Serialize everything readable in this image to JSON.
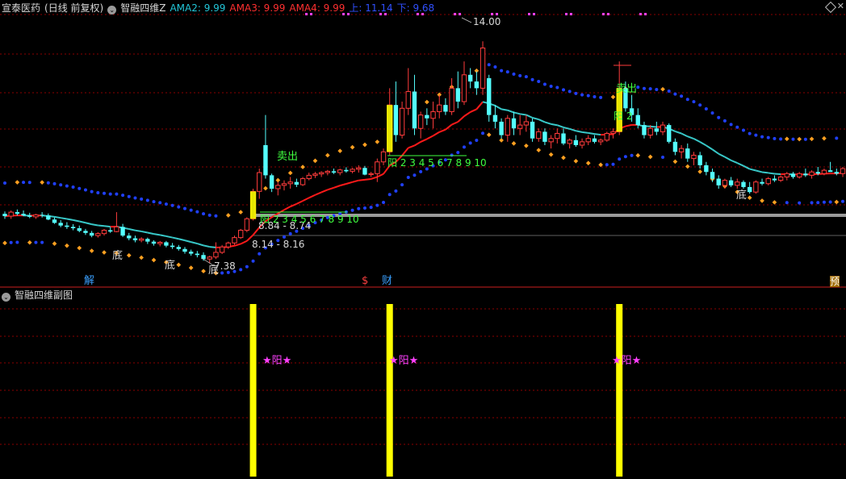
{
  "header": {
    "stock_name": "宣泰医药",
    "period": "(日线 前复权)",
    "indicator_name": "智融四维Z",
    "ama2_label": "AMA2: 9.99",
    "ama3_label": "AMA3: 9.99",
    "ama4_label": "AMA4: 9.99",
    "up_label": "上: 11.14",
    "down_label": "下: 9.68"
  },
  "sub_header": {
    "indicator_name": "智融四维副图"
  },
  "controls": {
    "close_glyph": "✕"
  },
  "annotations": {
    "peak_price": "14.00",
    "low_price": "7.38",
    "range_1": "8.14 - 8.16",
    "range_2": "8.84 - 8.74",
    "bottom_1": "底",
    "bottom_2": "底",
    "bottom_3": "底",
    "bottom_4": "底",
    "sell_1": "卖出",
    "sell_2": "卖出",
    "yang_count_1": "阳 2 3 4 5 6 7 8 9 10",
    "yang_count_2": "阳 2 3 4 5 6 7 8 9 10",
    "yang_count_3": "阳 2",
    "bottom_tag_jie": "解",
    "bottom_tag_dollar": "$",
    "bottom_tag_cai": "财",
    "bottom_tag_yu": "预",
    "sub_star_1": "★阳★",
    "sub_star_2": "★阳★",
    "sub_star_3": "★阳★"
  },
  "colors": {
    "background": "#000000",
    "candle_up": "#ff3c3c",
    "candle_down": "#54ffff",
    "ma_red": "#ff1a1a",
    "ma_cyan": "#38c8c8",
    "dots_blue": "#2040ff",
    "dots_orange": "#ffa020",
    "signal_yellow": "#ffff00",
    "grid_red": "#8b0000",
    "star_magenta": "#ff40ff"
  },
  "chart_data": {
    "type": "candlestick",
    "ohlc": [
      [
        8.85,
        8.92,
        8.7,
        8.78
      ],
      [
        8.78,
        8.95,
        8.7,
        8.9
      ],
      [
        8.9,
        8.98,
        8.8,
        8.85
      ],
      [
        8.85,
        8.95,
        8.78,
        8.8
      ],
      [
        8.8,
        8.88,
        8.72,
        8.76
      ],
      [
        8.76,
        8.85,
        8.7,
        8.82
      ],
      [
        8.82,
        8.9,
        8.74,
        8.8
      ],
      [
        8.8,
        8.86,
        8.66,
        8.68
      ],
      [
        8.68,
        8.74,
        8.55,
        8.58
      ],
      [
        8.58,
        8.66,
        8.45,
        8.5
      ],
      [
        8.5,
        8.6,
        8.4,
        8.46
      ],
      [
        8.46,
        8.54,
        8.36,
        8.42
      ],
      [
        8.42,
        8.5,
        8.3,
        8.34
      ],
      [
        8.34,
        8.4,
        8.22,
        8.28
      ],
      [
        8.28,
        8.34,
        8.15,
        8.2
      ],
      [
        8.2,
        8.3,
        8.14,
        8.26
      ],
      [
        8.26,
        8.4,
        8.2,
        8.36
      ],
      [
        8.36,
        8.45,
        8.28,
        8.32
      ],
      [
        8.32,
        8.9,
        8.3,
        8.46
      ],
      [
        8.46,
        8.55,
        8.16,
        8.2
      ],
      [
        8.2,
        8.28,
        8.06,
        8.12
      ],
      [
        8.12,
        8.2,
        8.0,
        8.06
      ],
      [
        8.06,
        8.15,
        8.0,
        8.1
      ],
      [
        8.1,
        8.14,
        7.95,
        8.02
      ],
      [
        8.02,
        8.06,
        7.9,
        7.96
      ],
      [
        7.96,
        8.04,
        7.88,
        8.0
      ],
      [
        8.0,
        8.04,
        7.85,
        7.9
      ],
      [
        7.9,
        7.98,
        7.8,
        7.86
      ],
      [
        7.86,
        7.92,
        7.75,
        7.8
      ],
      [
        7.8,
        7.86,
        7.66,
        7.72
      ],
      [
        7.72,
        7.78,
        7.6,
        7.66
      ],
      [
        7.66,
        7.74,
        7.55,
        7.62
      ],
      [
        7.62,
        7.7,
        7.45,
        7.5
      ],
      [
        7.5,
        7.6,
        7.38,
        7.56
      ],
      [
        7.56,
        8.0,
        7.5,
        7.7
      ],
      [
        7.7,
        7.92,
        7.65,
        7.86
      ],
      [
        7.86,
        8.02,
        7.8,
        7.98
      ],
      [
        7.98,
        8.2,
        7.92,
        8.14
      ],
      [
        8.14,
        8.4,
        8.1,
        8.36
      ],
      [
        8.36,
        8.75,
        8.3,
        8.7
      ],
      [
        8.7,
        9.6,
        8.65,
        9.52
      ],
      [
        9.52,
        10.2,
        9.3,
        10.08
      ],
      [
        10.9,
        11.8,
        9.9,
        10.0
      ],
      [
        10.0,
        10.05,
        9.5,
        9.6
      ],
      [
        9.6,
        9.8,
        9.4,
        9.7
      ],
      [
        9.7,
        9.85,
        9.55,
        9.75
      ],
      [
        9.75,
        9.95,
        9.6,
        9.8
      ],
      [
        9.8,
        9.9,
        9.65,
        9.72
      ],
      [
        9.72,
        9.95,
        9.68,
        9.9
      ],
      [
        9.9,
        10.08,
        9.85,
        10.0
      ],
      [
        10.0,
        10.1,
        9.92,
        10.04
      ],
      [
        10.04,
        10.12,
        9.95,
        10.08
      ],
      [
        10.08,
        10.16,
        10.0,
        10.12
      ],
      [
        10.12,
        10.2,
        10.04,
        10.08
      ],
      [
        10.08,
        10.2,
        10.0,
        10.16
      ],
      [
        10.16,
        10.24,
        10.08,
        10.12
      ],
      [
        10.12,
        10.22,
        10.06,
        10.18
      ],
      [
        10.18,
        10.3,
        10.08,
        10.22
      ],
      [
        10.22,
        10.28,
        10.0,
        10.02
      ],
      [
        10.02,
        10.1,
        9.95,
        10.05
      ],
      [
        10.05,
        10.5,
        9.8,
        10.4
      ],
      [
        10.4,
        10.8,
        10.3,
        10.7
      ],
      [
        10.7,
        12.6,
        10.6,
        12.1
      ],
      [
        12.1,
        12.8,
        11.0,
        11.2
      ],
      [
        11.2,
        12.2,
        11.1,
        12.0
      ],
      [
        12.0,
        13.2,
        11.8,
        12.5
      ],
      [
        12.5,
        13.0,
        11.2,
        11.4
      ],
      [
        11.4,
        11.9,
        11.1,
        11.8
      ],
      [
        11.8,
        12.0,
        11.5,
        11.7
      ],
      [
        11.7,
        12.2,
        11.4,
        11.9
      ],
      [
        11.9,
        12.4,
        11.7,
        12.1
      ],
      [
        12.1,
        12.3,
        11.8,
        11.9
      ],
      [
        11.9,
        12.9,
        11.8,
        12.6
      ],
      [
        12.6,
        13.1,
        12.0,
        12.2
      ],
      [
        12.2,
        13.4,
        12.1,
        13.0
      ],
      [
        13.0,
        13.2,
        12.6,
        12.8
      ],
      [
        12.8,
        13.1,
        12.4,
        12.6
      ],
      [
        12.6,
        14.0,
        12.4,
        13.8
      ],
      [
        12.9,
        13.0,
        11.6,
        11.8
      ],
      [
        11.8,
        12.1,
        11.4,
        11.6
      ],
      [
        11.6,
        11.7,
        11.1,
        11.2
      ],
      [
        11.2,
        11.8,
        11.0,
        11.7
      ],
      [
        11.7,
        11.9,
        11.2,
        11.4
      ],
      [
        11.4,
        11.8,
        11.2,
        11.5
      ],
      [
        11.5,
        11.8,
        11.3,
        11.6
      ],
      [
        11.6,
        11.7,
        11.0,
        11.1
      ],
      [
        11.1,
        11.4,
        11.0,
        11.3
      ],
      [
        11.3,
        11.4,
        10.9,
        11.0
      ],
      [
        11.0,
        11.2,
        10.8,
        11.1
      ],
      [
        11.1,
        11.4,
        10.95,
        11.25
      ],
      [
        11.25,
        11.4,
        10.9,
        10.95
      ],
      [
        10.95,
        11.1,
        10.8,
        11.05
      ],
      [
        11.05,
        11.2,
        10.85,
        10.9
      ],
      [
        10.9,
        11.1,
        10.8,
        11.0
      ],
      [
        11.0,
        11.2,
        10.9,
        11.1
      ],
      [
        11.1,
        11.2,
        10.95,
        11.0
      ],
      [
        11.0,
        11.1,
        10.9,
        11.05
      ],
      [
        11.05,
        11.3,
        11.0,
        11.25
      ],
      [
        11.25,
        11.4,
        11.1,
        11.3
      ],
      [
        11.3,
        13.4,
        11.2,
        12.6
      ],
      [
        12.6,
        12.8,
        11.9,
        12.0
      ],
      [
        12.0,
        12.4,
        11.6,
        11.8
      ],
      [
        11.8,
        12.0,
        11.4,
        11.5
      ],
      [
        11.5,
        11.6,
        11.1,
        11.2
      ],
      [
        11.2,
        11.5,
        11.1,
        11.4
      ],
      [
        11.4,
        11.6,
        11.2,
        11.3
      ],
      [
        11.3,
        11.6,
        11.2,
        11.5
      ],
      [
        11.5,
        11.55,
        10.95,
        11.0
      ],
      [
        11.0,
        11.1,
        10.6,
        10.7
      ],
      [
        10.7,
        10.9,
        10.5,
        10.8
      ],
      [
        10.8,
        10.95,
        10.4,
        10.5
      ],
      [
        10.5,
        10.7,
        10.3,
        10.6
      ],
      [
        10.6,
        10.7,
        10.2,
        10.3
      ],
      [
        10.3,
        10.4,
        10.0,
        10.1
      ],
      [
        10.1,
        10.2,
        9.8,
        9.9
      ],
      [
        9.9,
        10.0,
        9.6,
        9.7
      ],
      [
        9.7,
        9.9,
        9.6,
        9.85
      ],
      [
        9.85,
        9.95,
        9.65,
        9.7
      ],
      [
        9.7,
        9.9,
        9.6,
        9.8
      ],
      [
        9.8,
        9.85,
        9.6,
        9.65
      ],
      [
        9.65,
        9.8,
        9.45,
        9.5
      ],
      [
        9.5,
        9.85,
        9.45,
        9.8
      ],
      [
        9.8,
        9.9,
        9.7,
        9.75
      ],
      [
        9.75,
        9.95,
        9.7,
        9.9
      ],
      [
        9.9,
        10.0,
        9.8,
        9.85
      ],
      [
        9.85,
        10.0,
        9.8,
        9.95
      ],
      [
        9.95,
        10.1,
        9.85,
        10.05
      ],
      [
        10.05,
        10.1,
        9.9,
        9.95
      ],
      [
        9.95,
        10.1,
        9.9,
        10.05
      ],
      [
        10.05,
        10.2,
        9.95,
        10.0
      ],
      [
        10.0,
        10.15,
        9.9,
        10.1
      ],
      [
        10.1,
        10.25,
        10.0,
        10.05
      ],
      [
        10.05,
        10.2,
        10.0,
        10.15
      ],
      [
        10.15,
        10.4,
        10.1,
        10.1
      ],
      [
        10.1,
        10.2,
        10.0,
        10.05
      ],
      [
        10.05,
        10.25,
        9.95,
        10.2
      ]
    ],
    "ylim": [
      7.0,
      14.8
    ]
  }
}
